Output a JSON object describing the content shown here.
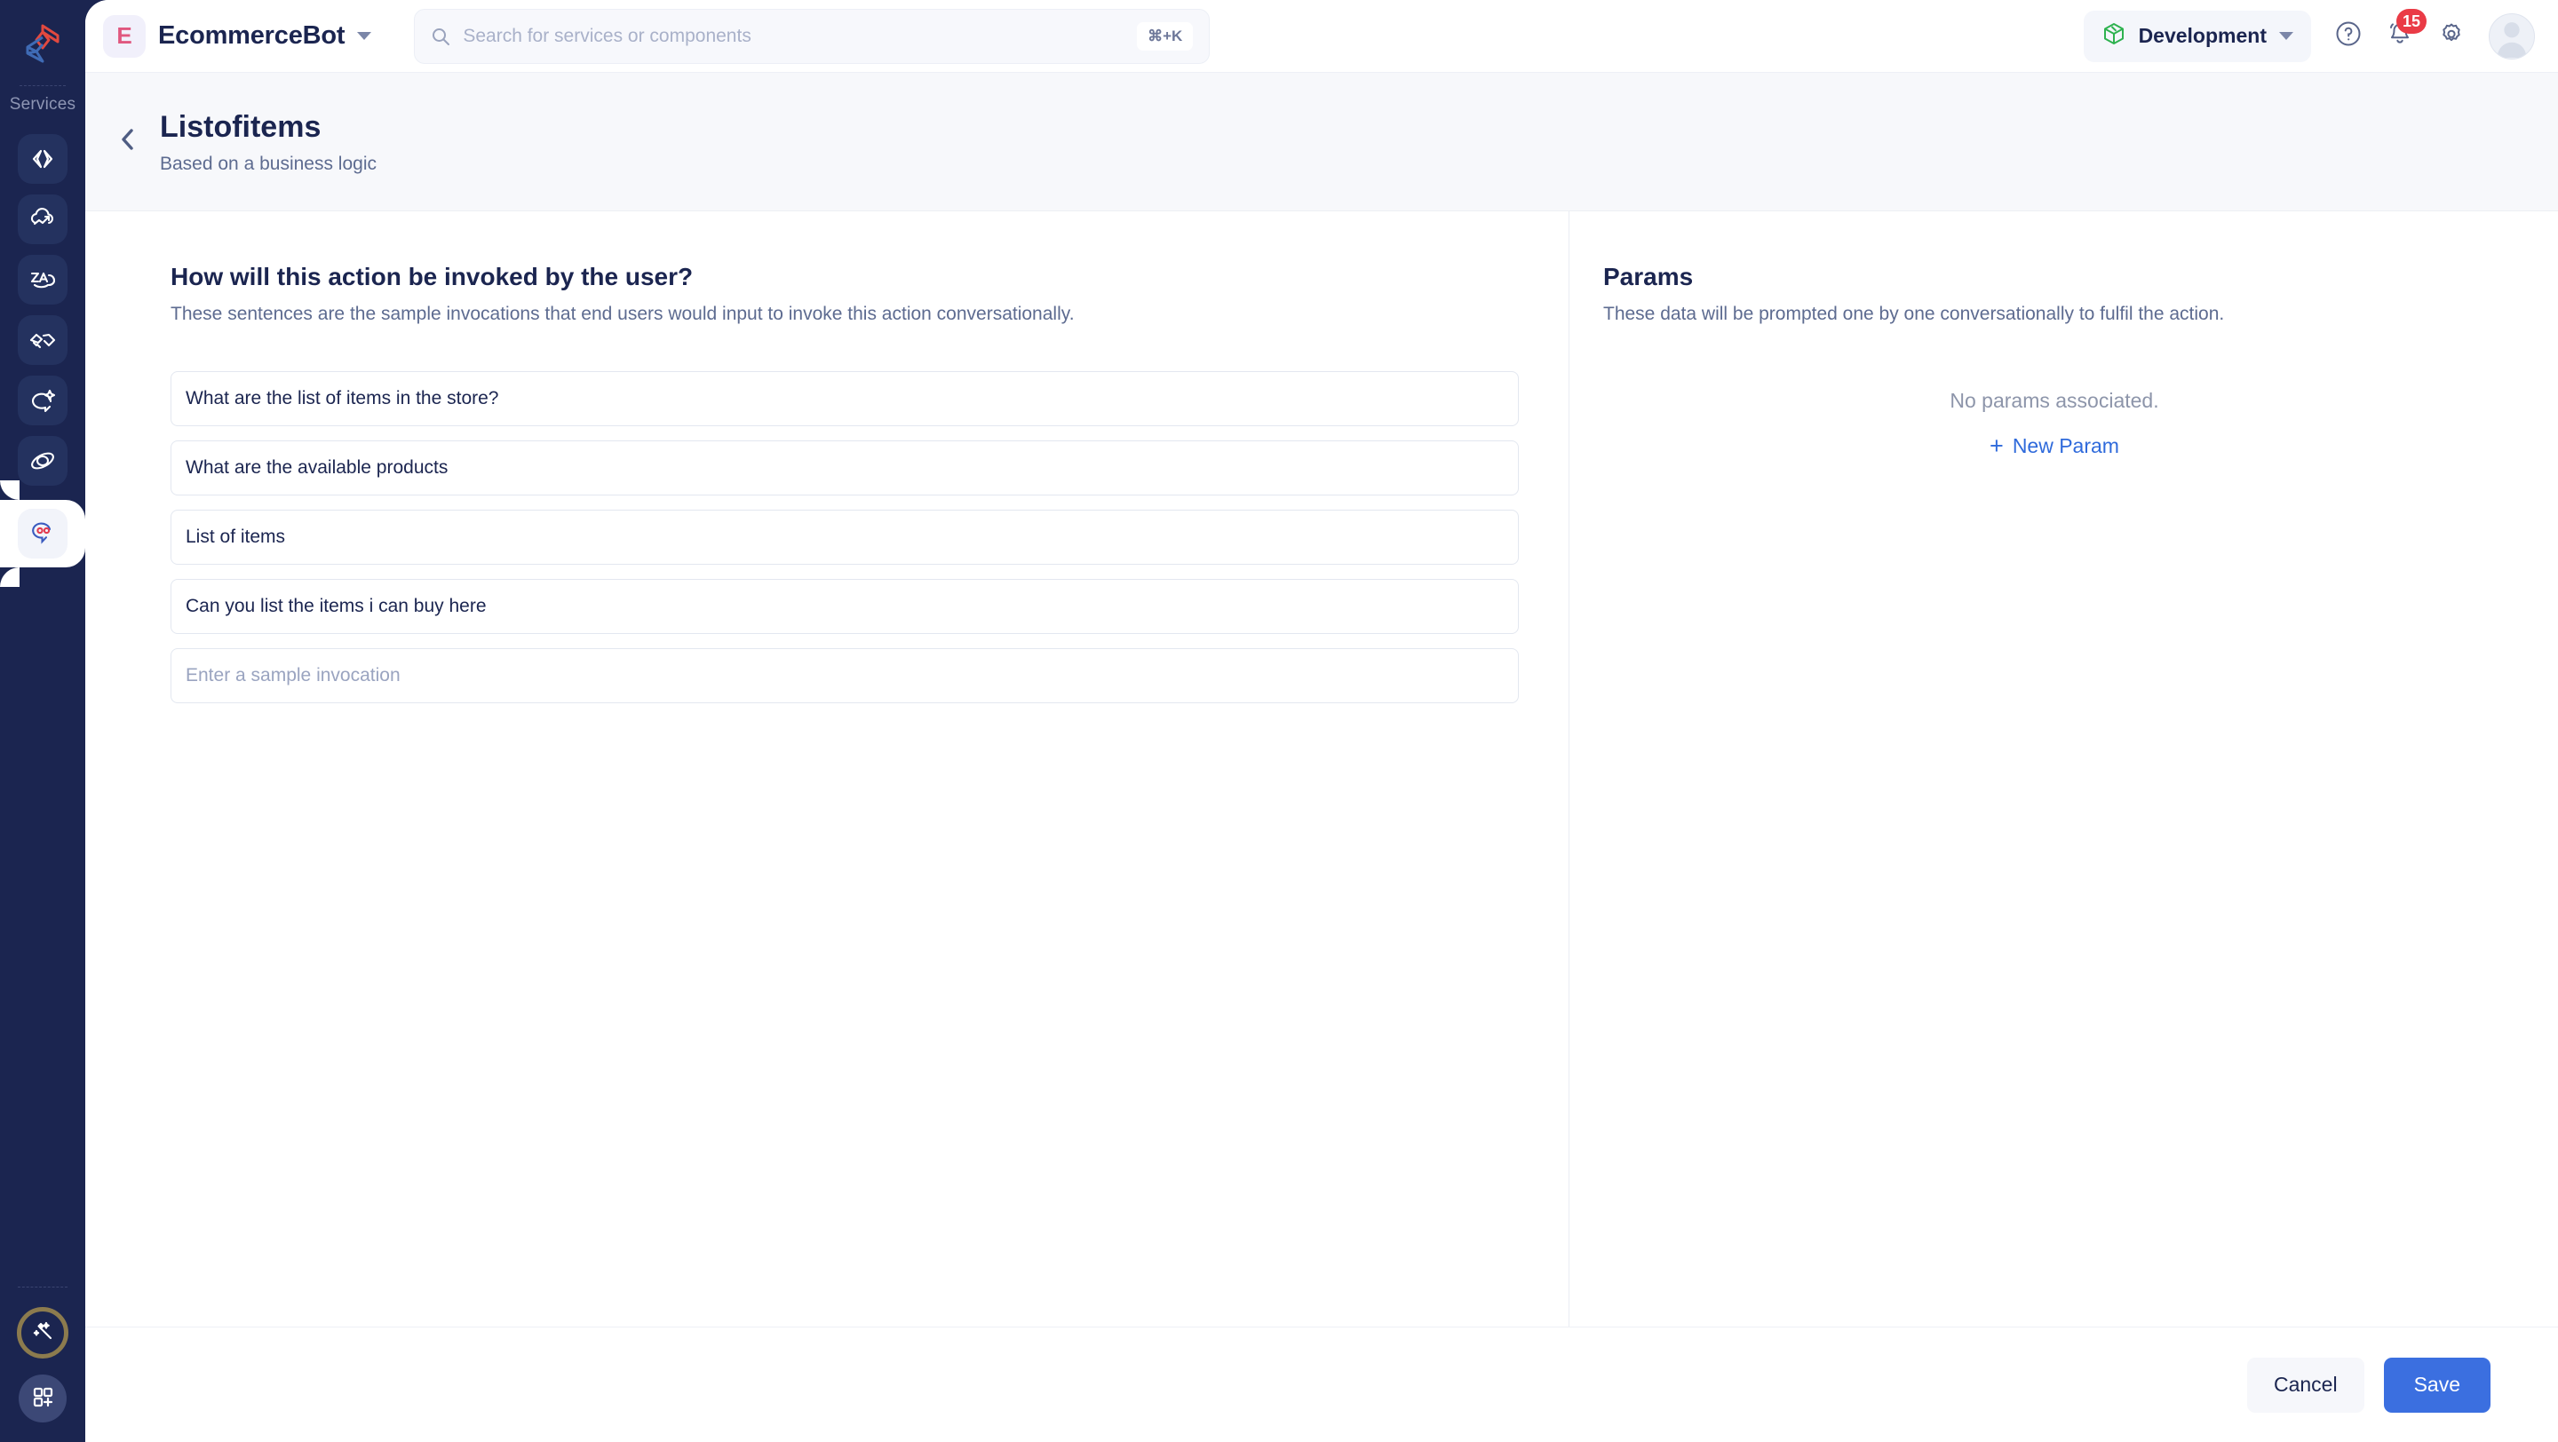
{
  "rail": {
    "logo_name": "app-logo",
    "section_label": "Services",
    "items": [
      {
        "icon": "code-brackets-icon",
        "name": "sidebar-item-code"
      },
      {
        "icon": "cloud-upload-icon",
        "name": "sidebar-item-cloud"
      },
      {
        "icon": "translate-icon",
        "name": "sidebar-item-translate"
      },
      {
        "icon": "handshake-icon",
        "name": "sidebar-item-integrations"
      },
      {
        "icon": "chat-sparkle-icon",
        "name": "sidebar-item-ai-chat"
      },
      {
        "icon": "orbit-icon",
        "name": "sidebar-item-orbit"
      }
    ],
    "active_item": {
      "icon": "chat-face-icon",
      "name": "sidebar-item-bot"
    },
    "bottom": [
      {
        "icon": "magic-wand-icon",
        "name": "magic-wand-button"
      },
      {
        "icon": "apps-grid-plus-icon",
        "name": "apps-grid-button"
      }
    ]
  },
  "topbar": {
    "bot_initial": "E",
    "bot_name": "EcommerceBot",
    "search": {
      "placeholder": "Search for services or components",
      "value": "",
      "shortcut": "⌘+K"
    },
    "environment": "Development",
    "notification_count": "15"
  },
  "pagehead": {
    "title": "Listofitems",
    "subtitle": "Based on a business logic"
  },
  "invocations": {
    "title": "How will this action be invoked by the user?",
    "description": "These sentences are the sample invocations that end users would input to invoke this action conversationally.",
    "items": [
      "What are the list of items in the store?",
      "What are the available products",
      "List of items",
      "Can you list the items i can buy here"
    ],
    "new_placeholder": "Enter a sample invocation"
  },
  "params": {
    "title": "Params",
    "description": "These data will be prompted one by one conversationally to fulfil the action.",
    "empty_text": "No params associated.",
    "new_param_label": "New Param",
    "plus": "+"
  },
  "footer": {
    "cancel_label": "Cancel",
    "save_label": "Save"
  },
  "colors": {
    "rail_bg": "#1b2550",
    "accent_blue": "#3b6fe0",
    "link_blue": "#2f6adb",
    "badge_red": "#ea3b46",
    "env_green": "#2eb24f",
    "avatar_pink": "#e0577f",
    "gold_ring": "#8c7b4e"
  }
}
